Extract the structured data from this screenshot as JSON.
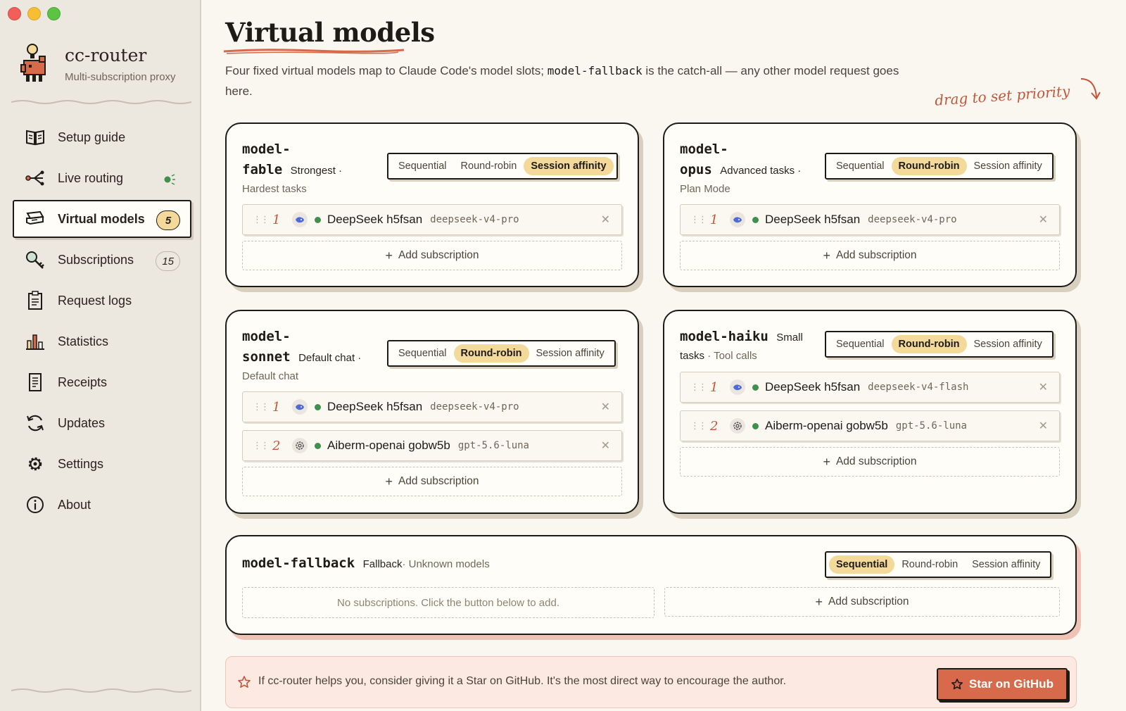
{
  "app": {
    "name": "cc-router",
    "subtitle": "Multi-subscription proxy"
  },
  "sidebar": {
    "items": [
      {
        "label": "Setup guide",
        "icon": "book-icon"
      },
      {
        "label": "Live routing",
        "icon": "routing-icon"
      },
      {
        "label": "Virtual models",
        "icon": "layers-icon",
        "badge": "5",
        "active": true
      },
      {
        "label": "Subscriptions",
        "icon": "key-icon",
        "badge": "15"
      },
      {
        "label": "Request logs",
        "icon": "clipboard-icon"
      },
      {
        "label": "Statistics",
        "icon": "bar-chart-icon"
      },
      {
        "label": "Receipts",
        "icon": "receipt-icon"
      },
      {
        "label": "Updates",
        "icon": "refresh-icon"
      },
      {
        "label": "Settings",
        "icon": "gear-icon"
      },
      {
        "label": "About",
        "icon": "info-icon"
      }
    ]
  },
  "page": {
    "title": "Virtual models",
    "desc_before": "Four fixed virtual models map to Claude Code's model slots; ",
    "desc_code": "model-fallback",
    "desc_after": " is the catch-all — any other model request goes here.",
    "drag_hint": "drag to set priority"
  },
  "strategies": [
    "Sequential",
    "Round-robin",
    "Session affinity"
  ],
  "add_label": "Add subscription",
  "cards": {
    "fable": {
      "name_a": "model-",
      "name_b": "fable",
      "tag": "Strongest ·",
      "desc": "Hardest tasks",
      "active_strategy": "Session affinity",
      "rows": [
        {
          "prio": "1",
          "provider": "DeepSeek h5fsan",
          "model": "deepseek-v4-pro",
          "icon": "whale-icon"
        }
      ]
    },
    "opus": {
      "name_a": "model-",
      "name_b": "opus",
      "tag": "Advanced tasks ·",
      "desc": "Plan Mode",
      "active_strategy": "Round-robin",
      "rows": [
        {
          "prio": "1",
          "provider": "DeepSeek h5fsan",
          "model": "deepseek-v4-pro",
          "icon": "whale-icon"
        }
      ]
    },
    "sonnet": {
      "name_a": "model-",
      "name_b": "sonnet",
      "tag": "Default chat ·",
      "desc": "Default chat",
      "active_strategy": "Round-robin",
      "rows": [
        {
          "prio": "1",
          "provider": "DeepSeek h5fsan",
          "model": "deepseek-v4-pro",
          "icon": "whale-icon"
        },
        {
          "prio": "2",
          "provider": "Aiberm-openai gobw5b",
          "model": "gpt-5.6-luna",
          "icon": "openai-icon"
        }
      ]
    },
    "haiku": {
      "name_a": "model-haiku",
      "tag": "Small",
      "tag2": "tasks",
      "desc": "· Tool calls",
      "active_strategy": "Round-robin",
      "rows": [
        {
          "prio": "1",
          "provider": "DeepSeek h5fsan",
          "model": "deepseek-v4-flash",
          "icon": "whale-icon"
        },
        {
          "prio": "2",
          "provider": "Aiberm-openai gobw5b",
          "model": "gpt-5.6-luna",
          "icon": "openai-icon"
        }
      ]
    },
    "fallback": {
      "name_a": "model-fallback",
      "tag": "Fallback",
      "desc": "· Unknown models",
      "active_strategy": "Sequential",
      "empty_text": "No subscriptions. Click the button below to add."
    }
  },
  "banner": {
    "text": "If cc-router helps you, consider giving it a Star on GitHub. It's the most direct way to encourage the author.",
    "button": "Star on GitHub"
  },
  "colors": {
    "accent": "#c0573b",
    "highlight": "#f3d99a",
    "button": "#d66a4a",
    "status_ok": "#3f8f4e"
  }
}
